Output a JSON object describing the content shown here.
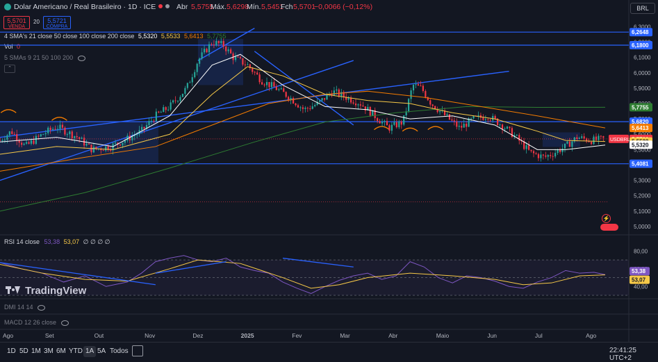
{
  "header": {
    "symbol_title": "Dolar Americano / Real Brasileiro · 1D · ICE",
    "ohlc": {
      "open_label": "Abr",
      "open": "5,5755",
      "high_label": "Máx.",
      "high": "5,6298",
      "low_label": "Mín.",
      "low": "5,5451",
      "close_label": "Fch",
      "close": "5,5701",
      "change": "−0,0066 (−0,12%)"
    },
    "currency": "BRL"
  },
  "trade": {
    "sell_price": "5,5701",
    "sell_label": "VENDA",
    "spread": "20",
    "buy_price": "5,5721",
    "buy_label": "COMPRA"
  },
  "indicators": {
    "sma_legend": "4 SMA's 21 close 50 close 100 close 200 close",
    "sma_values": [
      "5,5320",
      "5,5533",
      "5,6413",
      "5,7755"
    ],
    "vol_label": "Vol",
    "vol_value": "0",
    "smas2_legend": "5 SMAs 9 21 50 100 200",
    "rsi_legend": "RSI 14 close",
    "rsi_values": [
      "53,38",
      "53,07"
    ],
    "rsi_extra": "∅ ∅ ∅ ∅",
    "dmi_legend": "DMI 14 14",
    "macd_legend": "MACD 12 26 close"
  },
  "price_axis": {
    "ticks": [
      "6,3000",
      "6,2000",
      "6,1000",
      "6,0000",
      "5,9000",
      "5,8000",
      "5,7000",
      "5,6000",
      "5,5000",
      "5,4000",
      "5,3000",
      "5,2000",
      "5,1000",
      "5,0000"
    ],
    "markers": [
      {
        "label": "6,2648",
        "value": 6.2648,
        "bg": "#2962ff",
        "fg": "#ffffff"
      },
      {
        "label": "6,1800",
        "value": 6.18,
        "bg": "#2962ff",
        "fg": "#ffffff"
      },
      {
        "label": "5,7755",
        "value": 5.7755,
        "bg": "#2e7d32",
        "fg": "#ffffff"
      },
      {
        "label": "5,6820",
        "value": 5.682,
        "bg": "#2962ff",
        "fg": "#ffffff"
      },
      {
        "label": "5,6413",
        "value": 5.6413,
        "bg": "#f57c00",
        "fg": "#ffffff"
      },
      {
        "label": "5,5701",
        "value": 5.5701,
        "bg": "#f23645",
        "fg": "#ffffff"
      },
      {
        "label": "5,5533",
        "value": 5.5533,
        "bg": "#f7c948",
        "fg": "#131722"
      },
      {
        "label": "5,5320",
        "value": 5.532,
        "bg": "#ffffff",
        "fg": "#131722"
      },
      {
        "label": "5,4081",
        "value": 5.4081,
        "bg": "#2962ff",
        "fg": "#ffffff"
      }
    ],
    "symbol_tag": "USDBRL"
  },
  "rsi_axis": {
    "ticks": [
      "80,00",
      "60,00",
      "40,00"
    ],
    "markers": [
      {
        "label": "53,38",
        "value": 53.38,
        "bg": "#7e57c2",
        "fg": "#ffffff"
      },
      {
        "label": "53,07",
        "value": 53.07,
        "bg": "#f7c948",
        "fg": "#131722"
      }
    ]
  },
  "time_axis": {
    "labels": [
      "Ago",
      "Set",
      "Out",
      "Nov",
      "Dez",
      "2025",
      "Fev",
      "Mar",
      "Abr",
      "Maio",
      "Jun",
      "Jul",
      "Ago"
    ]
  },
  "timeframes": [
    "1D",
    "5D",
    "1M",
    "3M",
    "6M",
    "YTD",
    "1A",
    "5A",
    "Todos"
  ],
  "active_timeframe": "1A",
  "clock": "22:41:25 UTC+2",
  "watermark": "TradingView",
  "colors": {
    "background": "#131722",
    "up": "#26a69a",
    "down": "#f23645",
    "line_blue": "#2962ff",
    "sma21": "#ffffff",
    "sma50": "#f7c948",
    "sma100": "#f57c00",
    "sma200": "#2e7d32",
    "rsi": "#7e57c2",
    "rsi_ma": "#f7c948"
  },
  "chart_data": {
    "type": "candlestick",
    "period": "1D",
    "ylim": [
      4.95,
      6.32
    ],
    "x_labels": [
      "Ago",
      "Set",
      "Out",
      "Nov",
      "Dez",
      "2025",
      "Fev",
      "Mar",
      "Abr",
      "Maio",
      "Jun",
      "Jul",
      "Ago"
    ],
    "close_path": [
      [
        0,
        5.56
      ],
      [
        8,
        5.62
      ],
      [
        18,
        5.52
      ],
      [
        30,
        5.6
      ],
      [
        40,
        5.65
      ],
      [
        55,
        5.58
      ],
      [
        65,
        5.5
      ],
      [
        78,
        5.52
      ],
      [
        88,
        5.56
      ],
      [
        100,
        5.62
      ],
      [
        110,
        5.72
      ],
      [
        120,
        5.78
      ],
      [
        132,
        5.9
      ],
      [
        140,
        6.08
      ],
      [
        150,
        6.2
      ],
      [
        158,
        6.18
      ],
      [
        165,
        6.1
      ],
      [
        175,
        6.05
      ],
      [
        185,
        5.95
      ],
      [
        195,
        5.9
      ],
      [
        205,
        5.84
      ],
      [
        215,
        5.76
      ],
      [
        225,
        5.8
      ],
      [
        235,
        5.88
      ],
      [
        245,
        5.84
      ],
      [
        255,
        5.8
      ],
      [
        265,
        5.72
      ],
      [
        275,
        5.64
      ],
      [
        285,
        5.68
      ],
      [
        292,
        5.92
      ],
      [
        298,
        5.9
      ],
      [
        305,
        5.8
      ],
      [
        315,
        5.72
      ],
      [
        325,
        5.64
      ],
      [
        335,
        5.7
      ],
      [
        345,
        5.72
      ],
      [
        355,
        5.66
      ],
      [
        365,
        5.58
      ],
      [
        375,
        5.48
      ],
      [
        385,
        5.45
      ],
      [
        392,
        5.48
      ],
      [
        400,
        5.52
      ],
      [
        408,
        5.58
      ],
      [
        418,
        5.56
      ],
      [
        428,
        5.57
      ]
    ],
    "sma21": [
      [
        0,
        5.55
      ],
      [
        40,
        5.58
      ],
      [
        80,
        5.52
      ],
      [
        120,
        5.72
      ],
      [
        150,
        6.05
      ],
      [
        170,
        6.12
      ],
      [
        200,
        5.92
      ],
      [
        230,
        5.78
      ],
      [
        260,
        5.76
      ],
      [
        290,
        5.7
      ],
      [
        320,
        5.72
      ],
      [
        350,
        5.66
      ],
      [
        380,
        5.5
      ],
      [
        400,
        5.5
      ],
      [
        428,
        5.53
      ]
    ],
    "sma50": [
      [
        0,
        5.47
      ],
      [
        40,
        5.52
      ],
      [
        80,
        5.5
      ],
      [
        120,
        5.6
      ],
      [
        150,
        5.86
      ],
      [
        175,
        6.04
      ],
      [
        200,
        5.98
      ],
      [
        230,
        5.86
      ],
      [
        260,
        5.82
      ],
      [
        290,
        5.8
      ],
      [
        320,
        5.74
      ],
      [
        350,
        5.7
      ],
      [
        380,
        5.62
      ],
      [
        400,
        5.56
      ],
      [
        428,
        5.553
      ]
    ],
    "sma100": [
      [
        0,
        5.36
      ],
      [
        60,
        5.45
      ],
      [
        110,
        5.52
      ],
      [
        150,
        5.66
      ],
      [
        190,
        5.8
      ],
      [
        230,
        5.86
      ],
      [
        260,
        5.88
      ],
      [
        300,
        5.84
      ],
      [
        340,
        5.78
      ],
      [
        380,
        5.72
      ],
      [
        428,
        5.641
      ]
    ],
    "sma200": [
      [
        0,
        5.1
      ],
      [
        60,
        5.22
      ],
      [
        120,
        5.38
      ],
      [
        180,
        5.55
      ],
      [
        230,
        5.68
      ],
      [
        280,
        5.74
      ],
      [
        330,
        5.78
      ],
      [
        380,
        5.775
      ],
      [
        428,
        5.7755
      ]
    ],
    "horizontal_levels": [
      6.2648,
      6.18,
      5.682,
      5.4081
    ],
    "trendlines": [
      {
        "from": [
          0,
          5.3
        ],
        "to": [
          250,
          6.08
        ]
      },
      {
        "from": [
          0,
          5.58
        ],
        "to": [
          360,
          6.01
        ]
      },
      {
        "from": [
          140,
          6.08
        ],
        "to": [
          180,
          6.29
        ]
      },
      {
        "from": [
          180,
          6.14
        ],
        "to": [
          250,
          5.66
        ]
      }
    ],
    "rsi": [
      [
        0,
        67
      ],
      [
        15,
        60
      ],
      [
        30,
        55
      ],
      [
        45,
        45
      ],
      [
        60,
        52
      ],
      [
        75,
        40
      ],
      [
        90,
        45
      ],
      [
        100,
        55
      ],
      [
        110,
        68
      ],
      [
        120,
        72
      ],
      [
        130,
        75
      ],
      [
        140,
        70
      ],
      [
        150,
        68
      ],
      [
        160,
        72
      ],
      [
        170,
        62
      ],
      [
        180,
        58
      ],
      [
        190,
        55
      ],
      [
        200,
        45
      ],
      [
        210,
        38
      ],
      [
        220,
        32
      ],
      [
        230,
        40
      ],
      [
        240,
        47
      ],
      [
        250,
        52
      ],
      [
        260,
        55
      ],
      [
        270,
        48
      ],
      [
        280,
        52
      ],
      [
        290,
        68
      ],
      [
        300,
        62
      ],
      [
        310,
        50
      ],
      [
        320,
        44
      ],
      [
        330,
        52
      ],
      [
        340,
        50
      ],
      [
        350,
        46
      ],
      [
        360,
        40
      ],
      [
        370,
        38
      ],
      [
        380,
        45
      ],
      [
        390,
        50
      ],
      [
        400,
        58
      ],
      [
        410,
        55
      ],
      [
        420,
        56
      ],
      [
        428,
        53.38
      ]
    ],
    "rsi_ma": [
      [
        0,
        65
      ],
      [
        30,
        55
      ],
      [
        60,
        48
      ],
      [
        90,
        46
      ],
      [
        120,
        60
      ],
      [
        140,
        70
      ],
      [
        170,
        66
      ],
      [
        200,
        50
      ],
      [
        220,
        38
      ],
      [
        240,
        42
      ],
      [
        260,
        50
      ],
      [
        290,
        55
      ],
      [
        320,
        52
      ],
      [
        350,
        48
      ],
      [
        370,
        42
      ],
      [
        390,
        44
      ],
      [
        410,
        52
      ],
      [
        428,
        53.07
      ]
    ],
    "rsi_ylim": [
      30,
      85
    ]
  }
}
